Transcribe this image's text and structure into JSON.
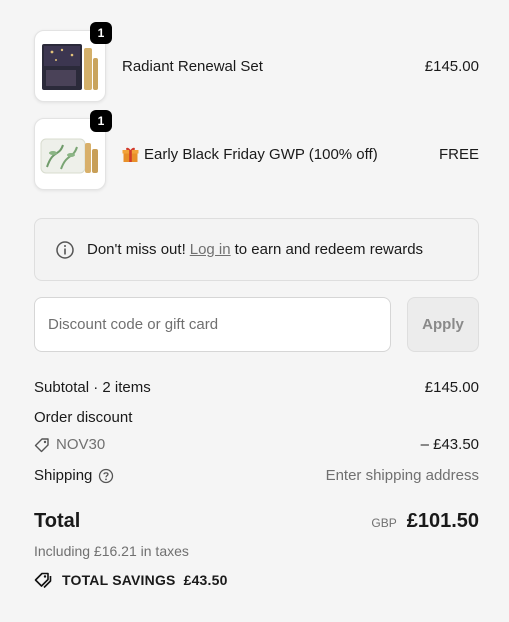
{
  "items": [
    {
      "name": "Radiant Renewal Set",
      "price": "£145.00",
      "quantity": "1",
      "image_icon": "skincare-set-image"
    },
    {
      "name": "Early Black Friday GWP (100% off)",
      "price": "FREE",
      "quantity": "1",
      "image_icon": "cosmetic-pouch-image",
      "prefix_icon": "gift-icon"
    }
  ],
  "notice": {
    "icon": "info-icon",
    "text_before": "Don't miss out!",
    "link_label": "Log in",
    "text_after": "to earn and redeem rewards"
  },
  "discount": {
    "placeholder": "Discount code or gift card",
    "value": "",
    "apply_label": "Apply"
  },
  "summary": {
    "subtotal_label": "Subtotal · 2 items",
    "subtotal_value": "£145.00",
    "order_discount_label": "Order discount",
    "discount_code": "NOV30",
    "discount_code_icon": "tag-icon",
    "discount_value": "– £43.50",
    "shipping_label": "Shipping",
    "shipping_help_icon": "help-circle-icon",
    "shipping_value": "Enter shipping address",
    "total_label": "Total",
    "currency": "GBP",
    "total_value": "£101.50",
    "taxes_note": "Including £16.21 in taxes",
    "savings_icon": "tags-icon",
    "savings_label": "TOTAL SAVINGS",
    "savings_value": "£43.50"
  },
  "colors": {
    "background": "#f5f5f5",
    "text": "#1a1a1a",
    "muted": "#707070",
    "badge": "#000000"
  }
}
